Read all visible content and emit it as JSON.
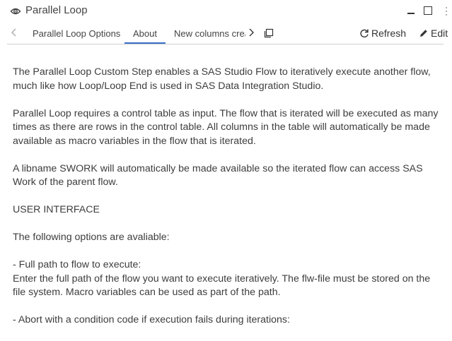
{
  "window": {
    "title": "Parallel Loop",
    "title_icon": "parallel-loop-icon",
    "controls": [
      "minimize-icon",
      "maximize-icon",
      "more-options-icon"
    ]
  },
  "tabs": {
    "items": [
      {
        "label": "Parallel Loop Options",
        "active": false
      },
      {
        "label": "About",
        "active": true
      },
      {
        "label": "New columns crea",
        "active": false
      }
    ],
    "active_color": "#3b6fc9"
  },
  "toolbar": {
    "refresh_label": "Refresh",
    "edit_label": "Edit"
  },
  "about": {
    "paragraphs": [
      "The Parallel Loop Custom Step enables a SAS Studio Flow to iteratively execute another flow,\nmuch like how Loop/Loop End is used in SAS Data Integration Studio.",
      "Parallel Loop requires a control table as input. The flow that is iterated will be executed as many\ntimes as there are rows in the control table. All columns in the table will automatically be made\navailable as macro variables in the flow that is iterated.",
      "A libname SWORK will automatically be made available so the iterated flow can access SAS\nWork of the parent flow.",
      "USER INTERFACE",
      "The following options are avaliable:",
      "- Full path to flow to execute:\nEnter the full path of the flow you want to execute iteratively. The flw-file must be stored on the\nfile system. Macro variables can be used as part of the path.",
      "- Abort with a condition code if execution fails during iterations:"
    ]
  }
}
